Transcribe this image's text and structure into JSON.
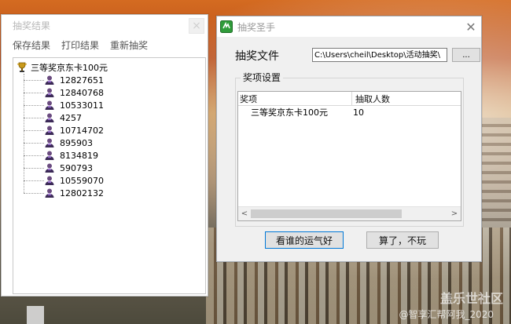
{
  "results_window": {
    "title": "抽奖结果",
    "close_glyph": "×",
    "menu": [
      "保存结果",
      "打印结果",
      "重新抽奖"
    ],
    "tree": {
      "root_label": "三等奖京东卡100元",
      "root_icon": "trophy-icon",
      "winners_icon": "user-icon",
      "winners": [
        "12827651",
        "12840768",
        "10533011",
        "4257",
        "10714702",
        "895903",
        "8134819",
        "590793",
        "10559070",
        "12802132"
      ]
    }
  },
  "main_window": {
    "title": "抽奖圣手",
    "close_glyph": "✕",
    "file_label": "抽奖文件",
    "file_path": "C:\\Users\\cheil\\Desktop\\活动抽奖\\",
    "browse_label": "...",
    "group_title": "奖项设置",
    "columns": [
      "奖项",
      "抽取人数"
    ],
    "rows": [
      {
        "prize": "三等奖京东卡100元",
        "count": "10"
      }
    ],
    "scroll_left": "<",
    "scroll_right": ">",
    "primary_button": "看谁的运气好",
    "secondary_button": "算了，不玩"
  },
  "watermark": {
    "line1": "盖乐世社区",
    "line2": "@智享汇帮阿我_2020"
  },
  "colors": {
    "accent_border": "#0078d7",
    "window_bg": "#f0f0f0"
  }
}
